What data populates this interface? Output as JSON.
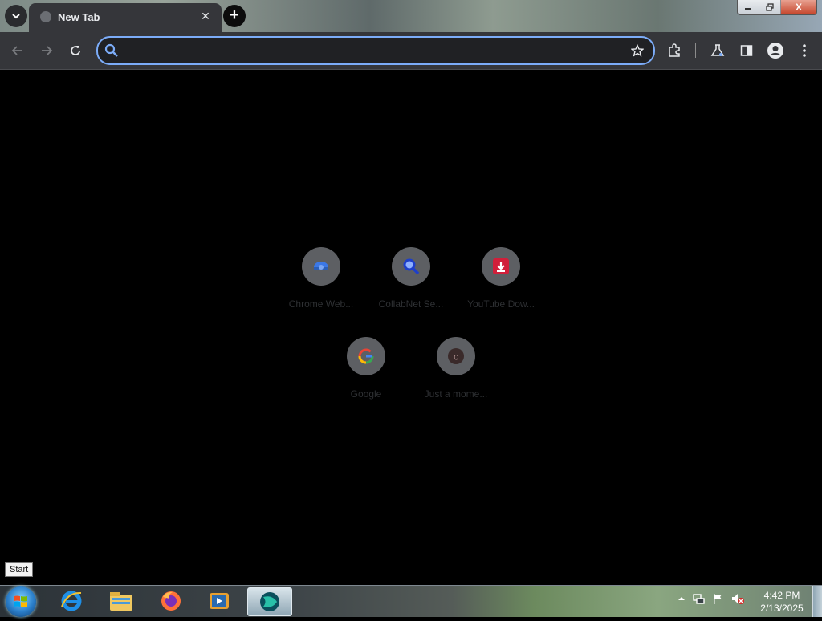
{
  "browser": {
    "tab": {
      "title": "New Tab",
      "close_icon": "close-icon"
    },
    "omnibox": {
      "value": "",
      "placeholder": ""
    },
    "toolbar_icons": [
      "back-arrow-icon",
      "forward-arrow-icon",
      "reload-icon",
      "bookmark-star-icon",
      "extensions-icon",
      "chrome-labs-icon",
      "side-panel-icon",
      "profile-icon",
      "menu-icon"
    ],
    "accent_color": "#7cacf8"
  },
  "window_controls": {
    "close_label": "X"
  },
  "shortcuts": [
    {
      "label": "Chrome Web...",
      "icon": "chrome-web-store-icon"
    },
    {
      "label": "CollabNet Se...",
      "icon": "magnifier-icon"
    },
    {
      "label": "YouTube Dow...",
      "icon": "download-icon"
    },
    {
      "label": "Google",
      "icon": "google-g-icon"
    },
    {
      "label": "Just a mome...",
      "icon": "letter-c-icon"
    }
  ],
  "tooltip": {
    "text": "Start"
  },
  "taskbar": {
    "apps": [
      "internet-explorer-icon",
      "file-explorer-icon",
      "firefox-icon",
      "media-player-icon",
      "active-app-icon"
    ],
    "clock": {
      "time": "4:42 PM",
      "date": "2/13/2025"
    }
  }
}
